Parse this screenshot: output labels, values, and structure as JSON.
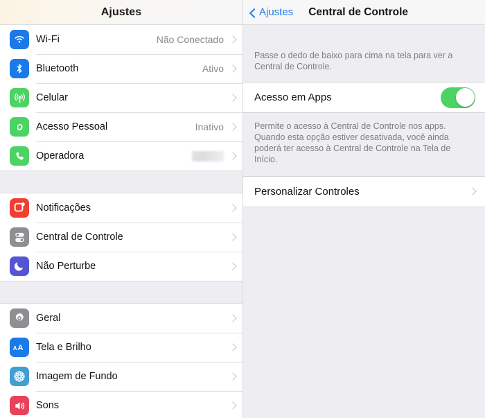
{
  "left": {
    "header": {
      "title": "Ajustes"
    },
    "groups": [
      {
        "rows": [
          {
            "label": "Wi-Fi",
            "value": "Não Conectado",
            "icon": "wifi-icon",
            "icon_color": "#1b7ae8"
          },
          {
            "label": "Bluetooth",
            "value": "Ativo",
            "icon": "bluetooth-icon",
            "icon_color": "#1b7ae8"
          },
          {
            "label": "Celular",
            "value": "",
            "icon": "cellular-antenna-icon",
            "icon_color": "#4cd364"
          },
          {
            "label": "Acesso Pessoal",
            "value": "Inativo",
            "icon": "personal-hotspot-icon",
            "icon_color": "#4cd364"
          },
          {
            "label": "Operadora",
            "value": "",
            "redacted": true,
            "icon": "phone-icon",
            "icon_color": "#4cd364"
          }
        ]
      },
      {
        "rows": [
          {
            "label": "Notificações",
            "value": "",
            "icon": "notifications-icon",
            "icon_color": "#f03e32"
          },
          {
            "label": "Central de Controle",
            "value": "",
            "icon": "control-center-icon",
            "icon_color": "#8e8e93"
          },
          {
            "label": "Não Perturbe",
            "value": "",
            "icon": "moon-icon",
            "icon_color": "#5555d4"
          }
        ]
      },
      {
        "rows": [
          {
            "label": "Geral",
            "value": "",
            "icon": "gear-icon",
            "icon_color": "#8e8e93"
          },
          {
            "label": "Tela e Brilho",
            "value": "",
            "icon": "display-brightness-icon",
            "icon_color": "#1b7ae8"
          },
          {
            "label": "Imagem de Fundo",
            "value": "",
            "icon": "wallpaper-flower-icon",
            "icon_color": "#3f9fd4"
          },
          {
            "label": "Sons",
            "value": "",
            "icon": "speaker-icon",
            "icon_color": "#e8415a"
          }
        ]
      }
    ]
  },
  "right": {
    "back_label": "Ajustes",
    "title": "Central de Controle",
    "note_top": "Passe o dedo de baixo para cima na tela para ver a Central de Controle.",
    "toggle_row": {
      "label": "Acesso em Apps",
      "toggle_state": "on",
      "toggle_on_color": "#4cd364"
    },
    "note_mid": "Permite o acesso à Central de Controle nos apps. Quando esta opção estiver desativada, você ainda poderá ter acesso à Central de Controle na Tela de Início.",
    "customize_row": {
      "label": "Personalizar Controles"
    }
  },
  "colors": {
    "accent_blue": "#1a7cf0",
    "group_bg": "#eeeef2",
    "card_bg": "#ffffff",
    "value_text": "#8b8b90"
  }
}
